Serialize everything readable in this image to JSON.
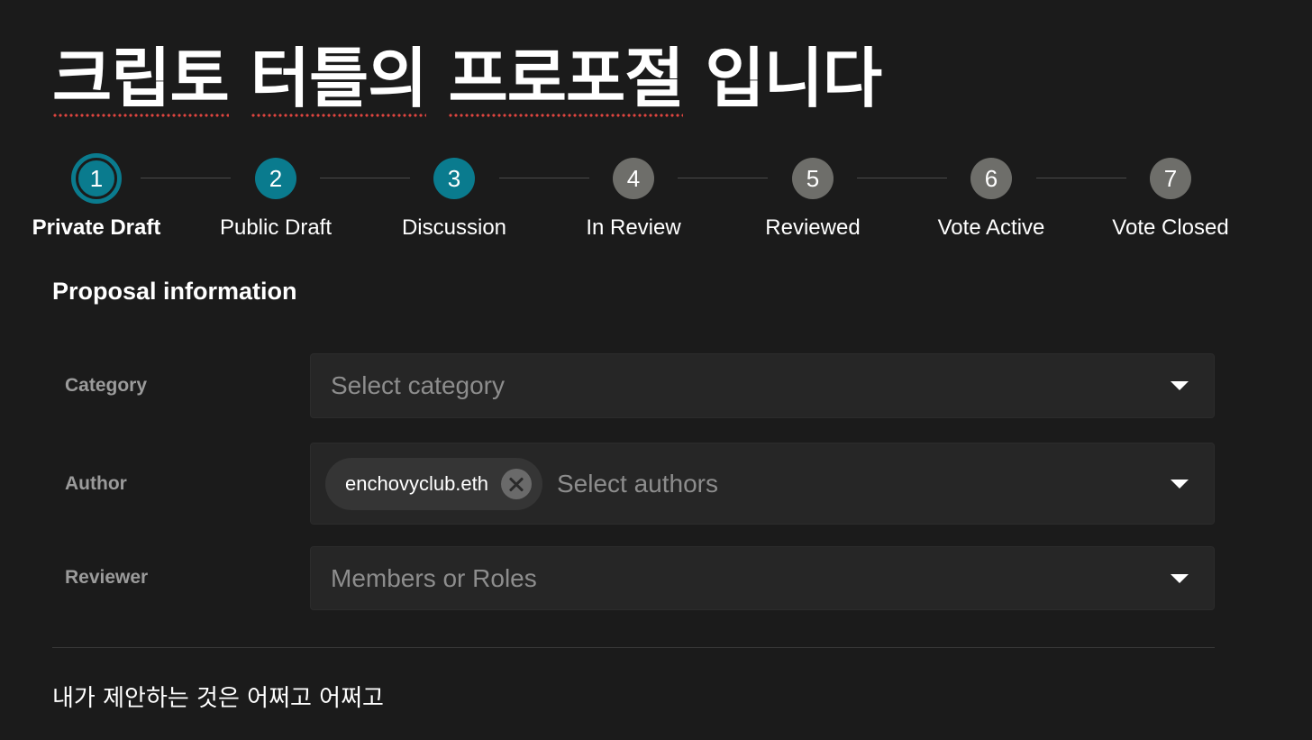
{
  "title": {
    "words": [
      "크립토",
      "터틀의",
      "프로포절",
      "입니다"
    ]
  },
  "stepper": {
    "steps": [
      {
        "number": "1",
        "label": "Private Draft",
        "state": "current"
      },
      {
        "number": "2",
        "label": "Public Draft",
        "state": "done"
      },
      {
        "number": "3",
        "label": "Discussion",
        "state": "done"
      },
      {
        "number": "4",
        "label": "In Review",
        "state": "todo"
      },
      {
        "number": "5",
        "label": "Reviewed",
        "state": "todo"
      },
      {
        "number": "6",
        "label": "Vote Active",
        "state": "todo"
      },
      {
        "number": "7",
        "label": "Vote Closed",
        "state": "todo"
      }
    ]
  },
  "section": {
    "title": "Proposal information"
  },
  "fields": {
    "category": {
      "label": "Category",
      "placeholder": "Select category"
    },
    "author": {
      "label": "Author",
      "chip": "enchovyclub.eth",
      "placeholder": "Select authors"
    },
    "reviewer": {
      "label": "Reviewer",
      "placeholder": "Members or Roles"
    }
  },
  "body": {
    "text": "내가 제안하는 것은 어쩌고 어쩌고"
  },
  "colors": {
    "background": "#1b1b1b",
    "accent_teal": "#0a7b8e",
    "inactive_step": "#6e6e6a",
    "input_bg": "#262626",
    "spellcheck_red": "#e0443f"
  }
}
